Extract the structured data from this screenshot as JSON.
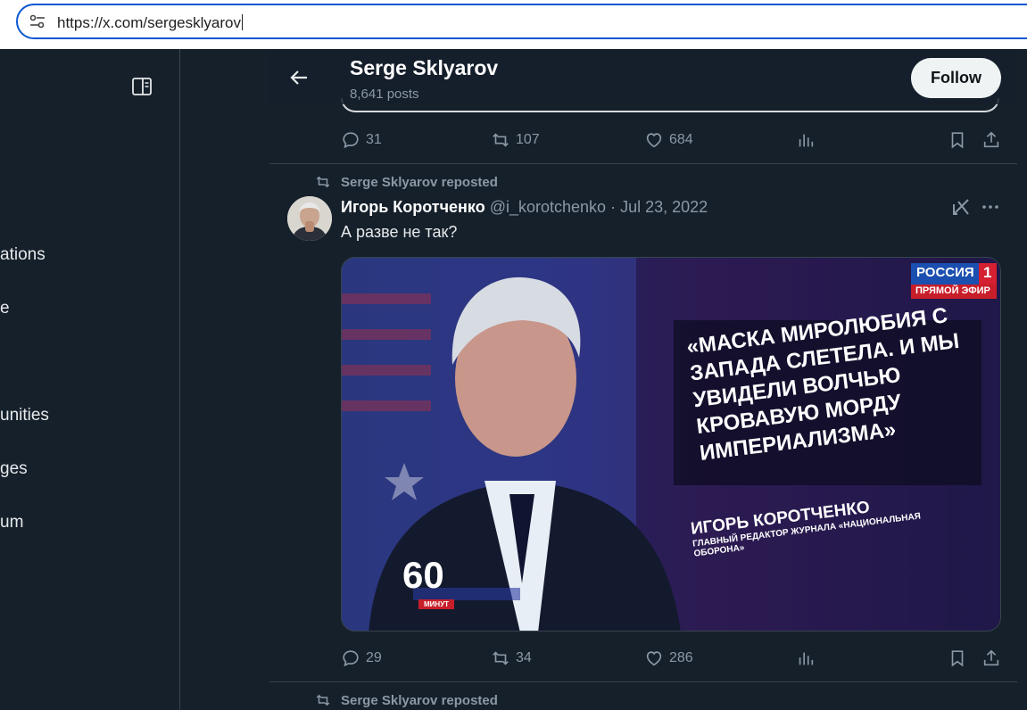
{
  "browser": {
    "url": "https://x.com/sergesklyarov"
  },
  "sidebar": {
    "items": [
      {
        "label": "ations"
      },
      {
        "label": "e"
      },
      {
        "label": "unities"
      },
      {
        "label": "ges"
      },
      {
        "label": "um"
      }
    ]
  },
  "profile_header": {
    "name": "Serge Sklyarov",
    "posts": "8,641 posts",
    "follow_label": "Follow"
  },
  "previous_tweet": {
    "replies": "31",
    "reposts": "107",
    "likes": "684"
  },
  "tweet": {
    "repost_label": "Serge Sklyarov reposted",
    "author_name": "Игорь Коротченко",
    "author_handle": "@i_korotchenko",
    "date": "Jul 23, 2022",
    "text": "А разве не так?",
    "replies": "29",
    "reposts": "34",
    "likes": "286",
    "media": {
      "channel": "РОССИЯ",
      "channel_number": "1",
      "live": "ПРЯМОЙ ЭФИР",
      "quote_lines": [
        "«МАСКА МИРОЛЮБИЯ С",
        "ЗАПАДА СЛЕТЕЛА. И МЫ",
        "УВИДЕЛИ ВОЛЧЬЮ",
        "КРОВАВУЮ МОРДУ",
        "ИМПЕРИАЛИЗМА»"
      ],
      "speaker": "ИГОРЬ КОРОТЧЕНКО",
      "speaker_title_1": "ГЛАВНЫЙ РЕДАКТОР ЖУРНАЛА «НАЦИОНАЛЬНАЯ",
      "speaker_title_2": "ОБОРОНА»",
      "show_number": "60",
      "show_label": "МИНУТ"
    }
  },
  "next_tweet": {
    "repost_label": "Serge Sklyarov reposted"
  }
}
